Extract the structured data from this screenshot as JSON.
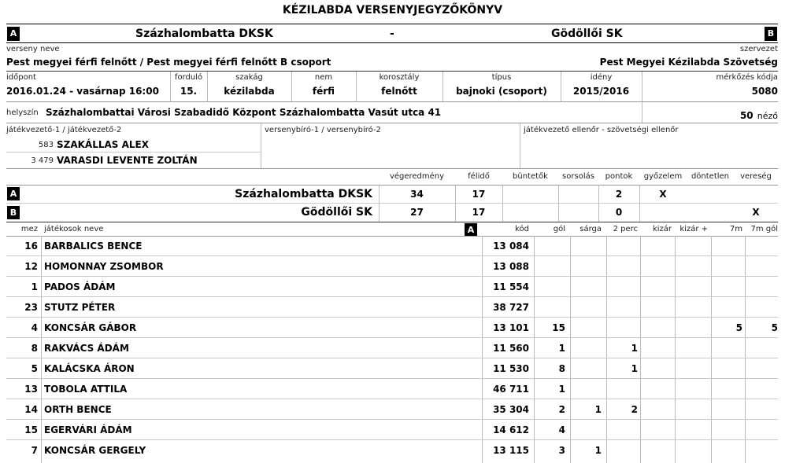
{
  "title": "KÉZILABDA VERSENYJEGYZŐKÖNYV",
  "teams": {
    "a_label": "A",
    "b_label": "B",
    "a_name": "Százhalombatta DKSK",
    "dash": "-",
    "b_name": "Gödöllői SK"
  },
  "competition": {
    "label": "verseny neve",
    "value": "Pest megyei férfi felnőtt / Pest megyei férfi felnőtt B csoport",
    "org_label": "szervezet",
    "org_value": "Pest Megyei Kézilabda Szövetség"
  },
  "info": {
    "time_label": "időpont",
    "time_value": "2016.01.24 - vasárnap 16:00",
    "round_label": "forduló",
    "round_value": "15.",
    "sport_label": "szakág",
    "sport_value": "kézilabda",
    "gender_label": "nem",
    "gender_value": "férfi",
    "age_label": "korosztály",
    "age_value": "felnőtt",
    "type_label": "típus",
    "type_value": "bajnoki (csoport)",
    "season_label": "idény",
    "season_value": "2015/2016",
    "code_label": "mérkőzés kódja",
    "code_value": "5080"
  },
  "venue": {
    "label": "helyszín",
    "value": "Százhalombattai Városi Szabadidő Központ Százhalombatta Vasút utca 41",
    "spectators": "50",
    "spectators_label": "néző"
  },
  "officials": {
    "referees_label": "játékvezető-1 / játékvezető-2",
    "ref1_id": "583",
    "ref1_name": "SZAKÁLLAS ALEX",
    "ref2_id": "3 479",
    "ref2_name": "VARASDI LEVENTE ZOLTÁN",
    "judges_label": "versenybíró-1 / versenybíró-2",
    "controller_label": "játékvezető ellenőr - szövetségi ellenőr"
  },
  "results_header": {
    "final": "végeredmény",
    "half": "félidő",
    "penalties": "büntetők",
    "draw": "sorsolás",
    "points": "pontok",
    "win": "győzelem",
    "tie": "döntetlen",
    "loss": "vereség"
  },
  "results": [
    {
      "label": "A",
      "team": "Százhalombatta DKSK",
      "final": "34",
      "half": "17",
      "points": "2",
      "win": "X",
      "loss": ""
    },
    {
      "label": "B",
      "team": "Gödöllői SK",
      "final": "27",
      "half": "17",
      "points": "0",
      "win": "",
      "loss": "X"
    }
  ],
  "players_header": {
    "number": "mez",
    "name": "játékosok neve",
    "team_label": "A",
    "code": "kód",
    "goals": "gól",
    "yellow": "sárga",
    "two_min": "2 perc",
    "excl": "kizár",
    "excl_plus": "kizár +",
    "seven_m": "7m",
    "seven_m_goal": "7m gól"
  },
  "players": [
    {
      "num": "16",
      "name": "BARBALICS BENCE",
      "code": "13 084",
      "goals": "",
      "yellow": "",
      "two": "",
      "sevenm": "",
      "sevenmg": ""
    },
    {
      "num": "12",
      "name": "HOMONNAY ZSOMBOR",
      "code": "13 088",
      "goals": "",
      "yellow": "",
      "two": "",
      "sevenm": "",
      "sevenmg": ""
    },
    {
      "num": "1",
      "name": "PADOS ÁDÁM",
      "code": "11 554",
      "goals": "",
      "yellow": "",
      "two": "",
      "sevenm": "",
      "sevenmg": ""
    },
    {
      "num": "23",
      "name": "STUTZ PÉTER",
      "code": "38 727",
      "goals": "",
      "yellow": "",
      "two": "",
      "sevenm": "",
      "sevenmg": ""
    },
    {
      "num": "4",
      "name": "KONCSÁR GÁBOR",
      "code": "13 101",
      "goals": "15",
      "yellow": "",
      "two": "",
      "sevenm": "5",
      "sevenmg": "5"
    },
    {
      "num": "8",
      "name": "RAKVÁCS ÁDÁM",
      "code": "11 560",
      "goals": "1",
      "yellow": "",
      "two": "1",
      "sevenm": "",
      "sevenmg": ""
    },
    {
      "num": "5",
      "name": "KALÁCSKA ÁRON",
      "code": "11 530",
      "goals": "8",
      "yellow": "",
      "two": "1",
      "sevenm": "",
      "sevenmg": ""
    },
    {
      "num": "13",
      "name": "TOBOLA ATTILA",
      "code": "46 711",
      "goals": "1",
      "yellow": "",
      "two": "",
      "sevenm": "",
      "sevenmg": ""
    },
    {
      "num": "14",
      "name": "ORTH BENCE",
      "code": "35 304",
      "goals": "2",
      "yellow": "1",
      "two": "2",
      "sevenm": "",
      "sevenmg": ""
    },
    {
      "num": "15",
      "name": "EGERVÁRI ÁDÁM",
      "code": "14 612",
      "goals": "4",
      "yellow": "",
      "two": "",
      "sevenm": "",
      "sevenmg": ""
    },
    {
      "num": "7",
      "name": "KONCSÁR GERGELY",
      "code": "13 115",
      "goals": "3",
      "yellow": "1",
      "two": "",
      "sevenm": "",
      "sevenmg": ""
    }
  ]
}
